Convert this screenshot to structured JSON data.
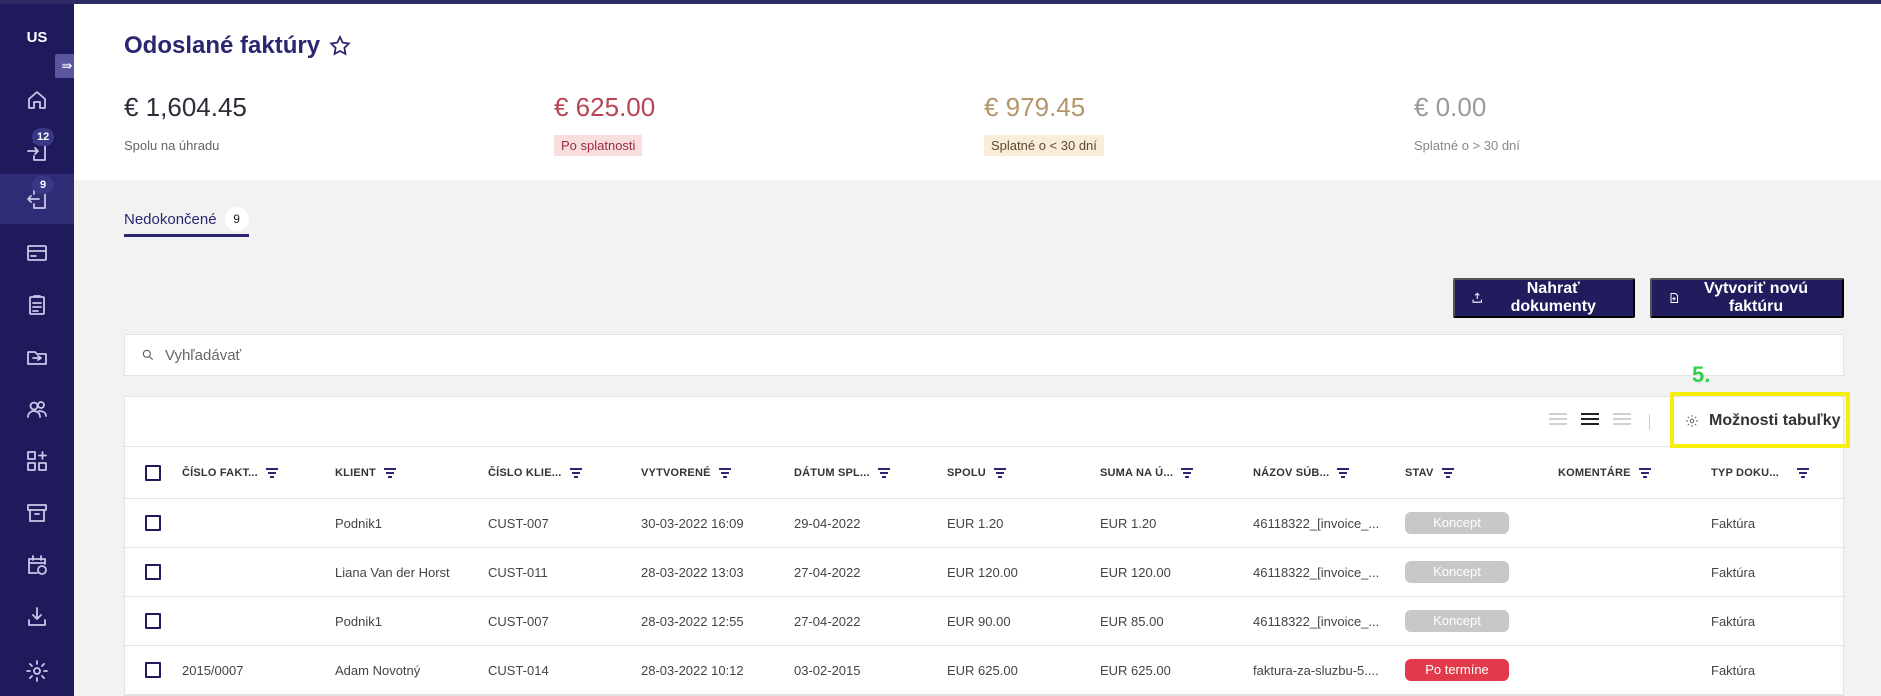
{
  "colors": {
    "sidebar_bg": "#1e1a5c",
    "accent": "#2a2670",
    "status_concept": "#c8c8c8",
    "status_overdue": "#e23a4a",
    "highlight": "#f6ee0c",
    "step_label": "#2fd04a"
  },
  "sidebar": {
    "logo": "US",
    "toggle_icon": "collapse-arrow-icon",
    "items": [
      {
        "icon": "home-icon"
      },
      {
        "icon": "document-incoming-icon",
        "badge": "12"
      },
      {
        "icon": "document-outgoing-icon",
        "badge": "9",
        "active": true
      },
      {
        "icon": "credit-card-icon"
      },
      {
        "icon": "clipboard-icon"
      },
      {
        "icon": "folder-transfer-icon"
      },
      {
        "icon": "contacts-icon"
      },
      {
        "icon": "apps-add-icon"
      },
      {
        "icon": "archive-icon"
      },
      {
        "icon": "calendar-sync-icon"
      },
      {
        "icon": "download-icon"
      },
      {
        "icon": "settings-icon"
      }
    ]
  },
  "header": {
    "title": "Odoslané faktúry",
    "stats": [
      {
        "amount": "€ 1,604.45",
        "label": "Spolu na úhradu"
      },
      {
        "amount": "€ 625.00",
        "label": "Po splatnosti"
      },
      {
        "amount": "€ 979.45",
        "label": "Splatné o < 30 dní"
      },
      {
        "amount": "€ 0.00",
        "label": "Splatné o > 30 dní"
      }
    ]
  },
  "tabs": [
    {
      "label": "Nedokončené",
      "count": "9"
    }
  ],
  "actions": {
    "upload_label": "Nahrať dokumenty",
    "create_label": "Vytvoriť novú faktúru"
  },
  "search": {
    "placeholder": "Vyhľadávať",
    "value": ""
  },
  "annotation": {
    "step": "5."
  },
  "table": {
    "options_label": "Možnosti tabuľky",
    "density_selected": "medium",
    "columns": [
      "ČÍSLO FAKT...",
      "KLIENT",
      "ČÍSLO KLIE...",
      "VYTVORENÉ",
      "DÁTUM SPL...",
      "SPOLU",
      "SUMA NA Ú...",
      "NÁZOV SÚB...",
      "STAV",
      "KOMENTÁRE",
      "TYP DOKU..."
    ],
    "rows": [
      {
        "invoice_no": "",
        "client": "Podnik1",
        "client_no": "CUST-007",
        "created": "30-03-2022 16:09",
        "due": "29-04-2022",
        "total": "EUR 1.20",
        "to_pay": "EUR 1.20",
        "file": "46118322_[invoice_...",
        "status": "Koncept",
        "status_type": "concept",
        "comments": "",
        "doc_type": "Faktúra"
      },
      {
        "invoice_no": "",
        "client": "Liana Van der Horst",
        "client_no": "CUST-011",
        "created": "28-03-2022 13:03",
        "due": "27-04-2022",
        "total": "EUR 120.00",
        "to_pay": "EUR 120.00",
        "file": "46118322_[invoice_...",
        "status": "Koncept",
        "status_type": "concept",
        "comments": "",
        "doc_type": "Faktúra"
      },
      {
        "invoice_no": "",
        "client": "Podnik1",
        "client_no": "CUST-007",
        "created": "28-03-2022 12:55",
        "due": "27-04-2022",
        "total": "EUR 90.00",
        "to_pay": "EUR 85.00",
        "file": "46118322_[invoice_...",
        "status": "Koncept",
        "status_type": "concept",
        "comments": "",
        "doc_type": "Faktúra"
      },
      {
        "invoice_no": "2015/0007",
        "client": "Adam Novotný",
        "client_no": "CUST-014",
        "created": "28-03-2022 10:12",
        "due": "03-02-2015",
        "total": "EUR 625.00",
        "to_pay": "EUR 625.00",
        "file": "faktura-za-sluzbu-5....",
        "status": "Po termíne",
        "status_type": "overdue",
        "comments": "",
        "doc_type": "Faktúra"
      }
    ]
  }
}
